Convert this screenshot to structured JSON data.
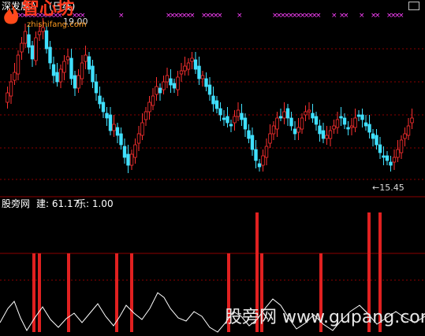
{
  "header": {
    "stock_title": "深发展A",
    "period": "(日线)",
    "window_icon": "window-restore-icon"
  },
  "price_chart": {
    "high_label": "19.00",
    "low_label": "←15.45",
    "colors": {
      "up": "#ff3030",
      "down": "#40e0ff",
      "grid": "#8b0000",
      "marker": "#ff40ff"
    }
  },
  "indicator": {
    "name": "股旁网",
    "jian_label": "建: 61.17",
    "le_label": "乐: 1.00",
    "colors": {
      "bar": "#e02020",
      "line": "#ffffff"
    }
  },
  "watermark": {
    "site": "股旁网 www.gupang.com",
    "logo": "智心坊",
    "logo_sub": "zhishifang.com"
  }
}
